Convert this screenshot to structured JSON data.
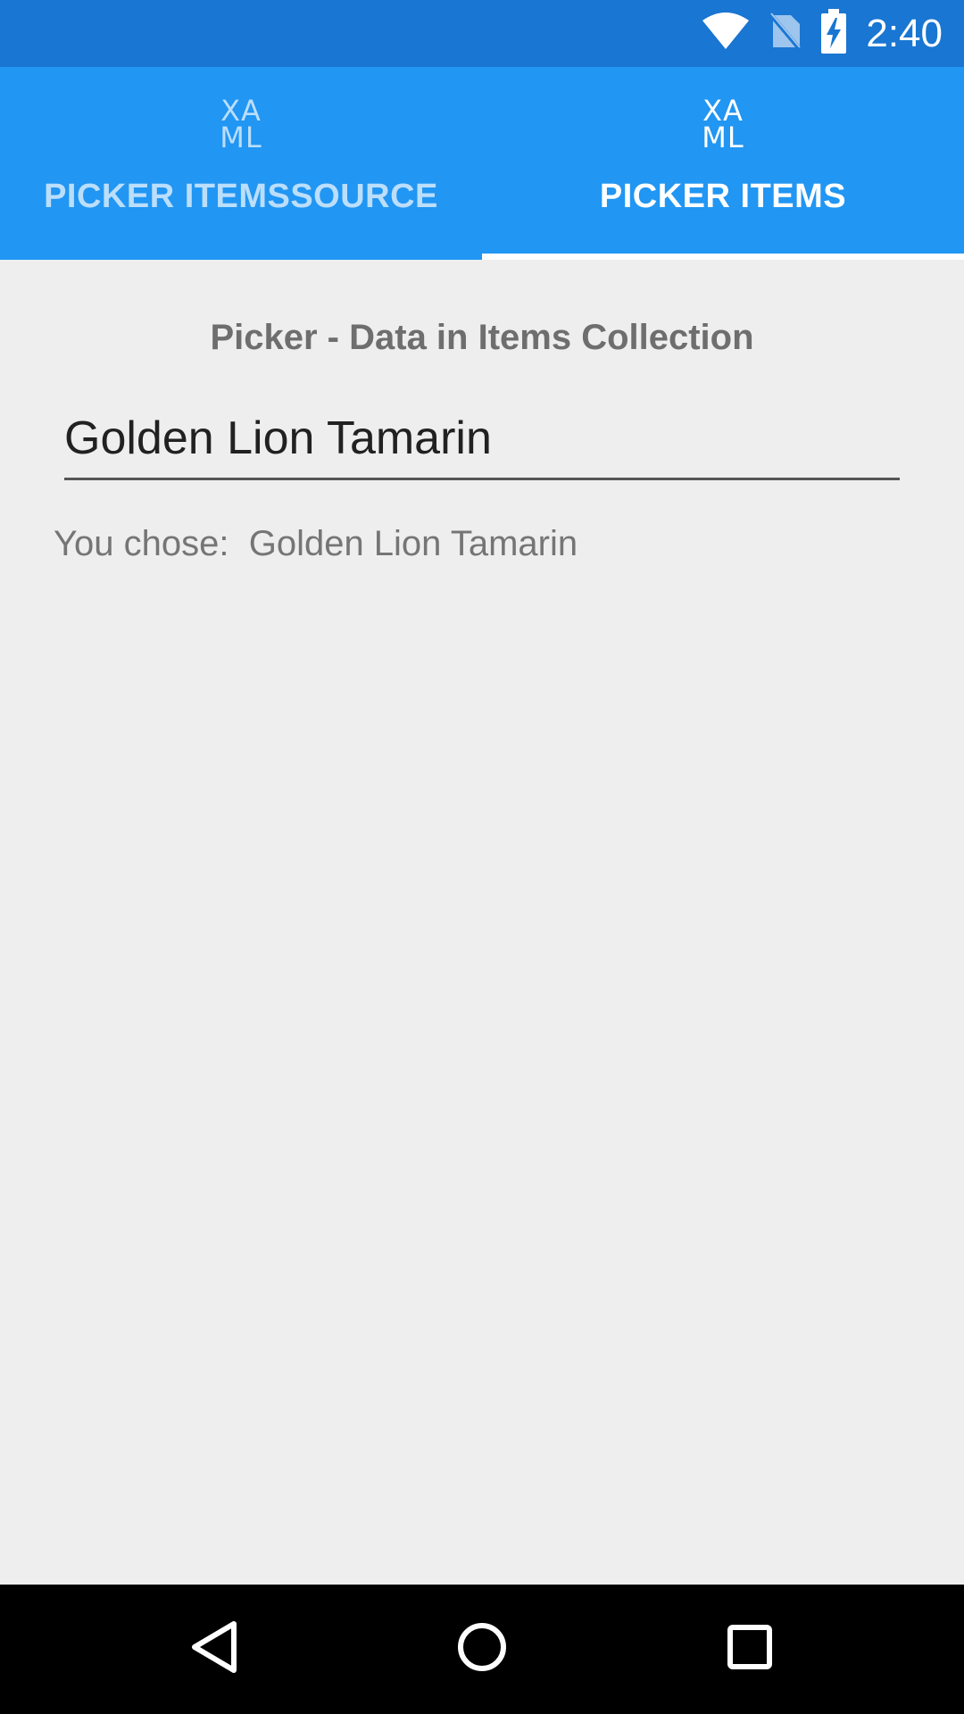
{
  "status_bar": {
    "time": "2:40",
    "icons": [
      "wifi-icon",
      "no-sim-icon",
      "battery-charging-icon"
    ]
  },
  "tabs": [
    {
      "icon_text": "XAML",
      "label": "PICKER ITEMSSOURCE",
      "selected": false
    },
    {
      "icon_text": "XAML",
      "label": "PICKER ITEMS",
      "selected": true
    }
  ],
  "page": {
    "heading": "Picker - Data in Items Collection",
    "picker_value": "Golden Lion Tamarin",
    "result_prefix": "You chose:",
    "result_value": "Golden Lion Tamarin"
  },
  "nav_bar": {
    "buttons": [
      "back-icon",
      "home-icon",
      "recents-icon"
    ]
  },
  "colors": {
    "status_bar": "#1976d2",
    "tab_bar": "#2196f3",
    "background": "#eeeeee",
    "nav_bar": "#000000"
  }
}
